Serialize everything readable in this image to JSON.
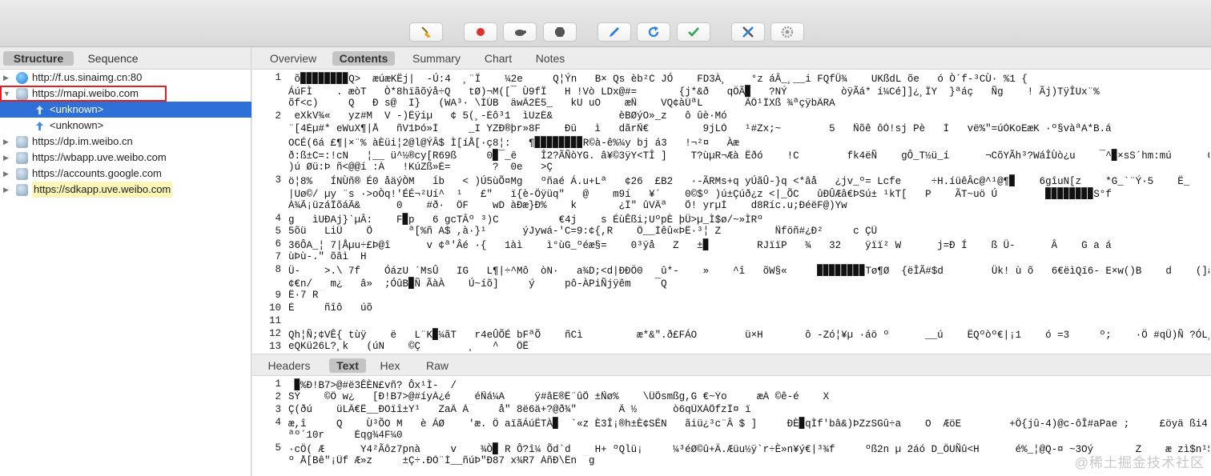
{
  "toolbar": {
    "buttons": [
      {
        "name": "broom-icon",
        "color": "#e8a317"
      },
      {
        "name": "record-icon",
        "color": "#e0312e"
      },
      {
        "name": "turtle-icon",
        "color": "#555555"
      },
      {
        "name": "stop-icon",
        "color": "#555555"
      },
      {
        "name": "pen-icon",
        "color": "#2a7de1"
      },
      {
        "name": "refresh-icon",
        "color": "#2a7de1"
      },
      {
        "name": "check-icon",
        "color": "#2fa84f"
      },
      {
        "name": "tools-icon",
        "color": "#2a7de1"
      },
      {
        "name": "settings-icon",
        "color": "#999999"
      }
    ]
  },
  "left_tabs": {
    "structure": "Structure",
    "sequence": "Sequence"
  },
  "tree": [
    {
      "label": "http://f.us.sinaimg.cn:80",
      "icon": "globe-icon",
      "expanded": false,
      "level": 0
    },
    {
      "label": "https://mapi.weibo.com",
      "icon": "lock-globe-icon",
      "expanded": true,
      "level": 0,
      "highlight_box": true
    },
    {
      "label": "<unknown>",
      "icon": "upload-arrow-icon",
      "expanded": false,
      "level": 1,
      "selected": true
    },
    {
      "label": "<unknown>",
      "icon": "upload-arrow-icon",
      "expanded": false,
      "level": 1
    },
    {
      "label": "https://dp.im.weibo.cn",
      "icon": "lock-globe-icon",
      "expanded": false,
      "level": 0
    },
    {
      "label": "https://wbapp.uve.weibo.com",
      "icon": "lock-globe-icon",
      "expanded": false,
      "level": 0
    },
    {
      "label": "https://accounts.google.com",
      "icon": "lock-globe-icon",
      "expanded": false,
      "level": 0
    },
    {
      "label": "https://sdkapp.uve.weibo.com",
      "icon": "lock-globe-icon",
      "expanded": false,
      "level": 0,
      "yellow": true
    }
  ],
  "content_tabs": [
    "Overview",
    "Contents",
    "Summary",
    "Chart",
    "Notes"
  ],
  "content_active": "Contents",
  "body_tabs": [
    "Headers",
    "Text",
    "Hex",
    "Raw"
  ],
  "body_active": "Text",
  "request_lines": [
    {
      "n": "1",
      "text": " õ▉▉▉▉▉▉▉▉Q>  æúæKËj|  -Ú:4  ¸¨Ï    ¼2e     Q¦Ýn   B× Qs èb²C JÓ    FD3À¸    °z áÂ_¸__i FQfÜ¾    UKßdL õe   ó Ò´f-³CÙ· %1 {"
    },
    {
      "n": "",
      "text": "ÁúFÌ    . æòT   Ò*8hïãõýå÷Q   tØ)¬M([¯ Ù9fÏ   H !Vò LDx@#=       {j*&ð   qÖÃ▉   ?NÝ         òÿÃá* í¼Cé]]¿¸ÏY  }ªáç   Ñg    ! Ãj)TÿÎUx¨%"
    },
    {
      "n": "",
      "text": "õf<c)     Q   Ð s@  I}   (WA³· \\ÍÙB  äwÄ2É5_   kU uO    æÑ    VQ¢àÚªL       ÃÔ¹ÏXß ¾ªçÿbÄRA"
    },
    {
      "n": "2",
      "text": " eXkV¾«   yz#M  V -)Êÿiµ   ¢ 5(¸-Éô³1  ìUzÉ&           èBØýO»_z   ô ûè·Mó"
    },
    {
      "n": "",
      "text": "¨[4Éµ#* eWuX¶|Å   ñV1Þó»Ì     _I YZÐ®þr»8F    Ðü   ì   dãrÑ€         9jLÒ   ¹#Zx;~        5   Ñõê ôÓ!sj Pè   Ì   vë%\"=úÓKoEæK ·º§vàªA*B.á"
    },
    {
      "n": "",
      "text": "OCÉ(6á £¶|×¨% àÈüi¦2@l@ÝÂ$ Ì[íÅ[·ç8¦:   ¶▉▉▉▉▉▉▉▉R©à-ê%¼y bj á3   !¬²¤   Àæ"
    },
    {
      "n": "",
      "text": "ð:ß±C=:!cN   ¦__ ü^½®cy[R69ß     0▉¯_ë    Î2?ÃÑòYG. â¥©3ÿY<TÎ ]    T?ùµR¬Æà Ëðó    !C        fk4ëÑ    gÔ_T½ü_í      ¬CõYÃh³?WáÎÙò¿u    ¯^▉×sS´hm:mú      QªjQÎ¤n ð-W=4Áv9"
    },
    {
      "n": "",
      "text": ")ú Øü:Þ ñ<@@í :À   !KúZß»È=       ?  0e   >Ç"
    },
    {
      "n": "3",
      "text": "ö¦8%   ÍNÙñ® É0 åäýÒM   ĺb   < )Ú5ùÕ¤Mg   ºñaé Á.u+Lª   ¢26  £B2   ·-ÃRMs+q yÚãÛ-}q <*âå   ¿jv_º= Lcfe     ÷H.íüêÂc@^¹@¶▉    6gîuN[z    *G_`¨Ý·5    Ë_         +"
    },
    {
      "n": "",
      "text": "|Uø©/ µy ¨s ·>oÒq!'ÉÉ¬²Uí^  ¹   £\"   ï{è-Öÿüq\"   @    m9í   ¥´    0©$º )ú±Çúð¿z <|_ÕC   ûÐÛÆâ€ÞSú± ¹kT[   P    ÃT~uö Ú        ▉▉▉▉▉▉▉▉S°f"
    },
    {
      "n": "",
      "text": "À¾Ã¡üzáÎõáÃ&      0    #ð·  ÔF    wD àÐæ}Ð%    k       ¿Î\" ûVÂª   Õ! yrµÌ    d8Ríc.u;ÐéëF@)Yw"
    },
    {
      "n": "4",
      "text": "g   ìUÐAj}`µÂ:    F▉p   6 gcTÂº ³)C          €4j    s ÉùÊßi;UºpÈ þÜ>µ_Ì$ø/~»ÌRº"
    },
    {
      "n": "5",
      "text": "5õü   LiÛ    Õ      ª[%ñ A$ ,à·}¹      ýJywá-'C=9:¢{,R    Ô__Ìêû«ÞÊ·³¦ Z         Ñföñ#¿Ð²     c ÇÜ"
    },
    {
      "n": "6",
      "text": "36ÔA_¦ 7|Åµu÷£Þ@î      v ¢ª'Âé ·{   1àì    ì°ùG_ºéæ§=    0³ÿå   Z   ±▉        RJïïP   ¾   32    ÿïï² W      j=Ð Í    ß Ü-      Â    G a á"
    },
    {
      "n": "7",
      "text": "ùÞù-.\" õâì  H"
    },
    {
      "n": "8",
      "text": "Ü-    >.\\ 7f    ÓázU ´MsÛ   IG   L¶|÷^Mô  òN·   a¾D;<d|ÐÐÖ0   û*-    »    ^î   õW§«     ▉▉▉▉▉▉▉▉Tø¶Ø  {ëÎÃ#$d        Ük! ù õ   6€ëìQï6- E×w()B    d    (]à   VüèU     »         ÁÎÍS"
    },
    {
      "n": "",
      "text": "¢€n/   m¿   â»  ;ÓûB▉Ñ ÃàÀ    Ú~íõ]     ý     pô-ÀPiÑjÿêm    ¯Q"
    },
    {
      "n": "9",
      "text": "Ê·7 R¯"
    },
    {
      "n": "10",
      "text": "È     ñîô   úõ"
    },
    {
      "n": "11",
      "text": ""
    },
    {
      "n": "12",
      "text": "Qh¦Ñ;¢VÊ{ tùÿ    ë   L¨K▉¼ãT   r4eÛÕÉ bFªÕ    ñCì         æ*&\".ð£FÁO        ü×H       ô -Zó¦¥µ ·áö º      __ú    ËQºòº€|¡1    ó =3     º;    ·Ö #qÜ)Ñ ?ÓL¸¥]wX© Ï´    $ó    º-N=²¾kL v"
    },
    {
      "n": "13",
      "text": "eQKü26L?¸k   (úN    ©Ç        ¸   ^   ÔÊ¯"
    }
  ],
  "response_lines": [
    {
      "n": "1",
      "text": " ▉%Ð!B7>@#ë3ÊÈN£vñ? Ôx¹Ì-  /"
    },
    {
      "n": "2",
      "text": "SÝ    ©Ô w¿   [Ð!B7>@#íyÀ¿é    éÑá¼A     ÿ#âE®Ë¨ûÕ ±Ñø%    \\ÜÕsmßg,G €~Ýo     æÁ ©ê-é    X"
    },
    {
      "n": "3",
      "text": "Ç(ðú    üLÂ€Ê__ÐOïî±Y¹   ZaÄ Á¯    å\" 8ë6ä+?@ð¾\"       Â ½      ò6qÙXÀÔfzÏ¤ ï"
    },
    {
      "n": "4",
      "text": "æ,î     Q    Ù³ÕO M   è ÁØ    'æ. Ö aïãÁúËTÀ▉  `«z È3Î¡®h±È¢SËN   ãiü¿³c¨Â $ ]     ÐÈ▉qÌf'bâ&)ÞZzSGû÷a    O  ÆöE        +Ö{jû-4)@c-ôÎ#aPae ;     £öyä ßi4 hÎâ¹ \\    Ë \\ þÃ{    úýÌÒiT"
    },
    {
      "n": "",
      "text": "ªº´10r     Éqg¾4F¼0"
    },
    {
      "n": "5",
      "text": "·cÖ( Æ      Y4²Ãôz7pnà     v    ¾Ò▉ R Ô?î¼ Õd`d    H+ ºQlü¡     ¼³éØ©û+Ä.Æüu½ÿ`r÷È»n¥ý€|³¾f     ºß2n µ 2áó D_ÖUÑû<H      é%_¦@Q-¤ ~3Oý       Z    æ zì$n¹$rý·ä+ÄÈ    Â <Ì"
    },
    {
      "n": "",
      "text": "º Å[Bê\"¡Ûf Æ»z     ±Ç÷.ÐÒ¨Ì__ñúÞ\"Ð87 x¾R7 ÁñÐ\\Ën ¯g"
    }
  ],
  "watermark": "@稀土掘金技术社区"
}
